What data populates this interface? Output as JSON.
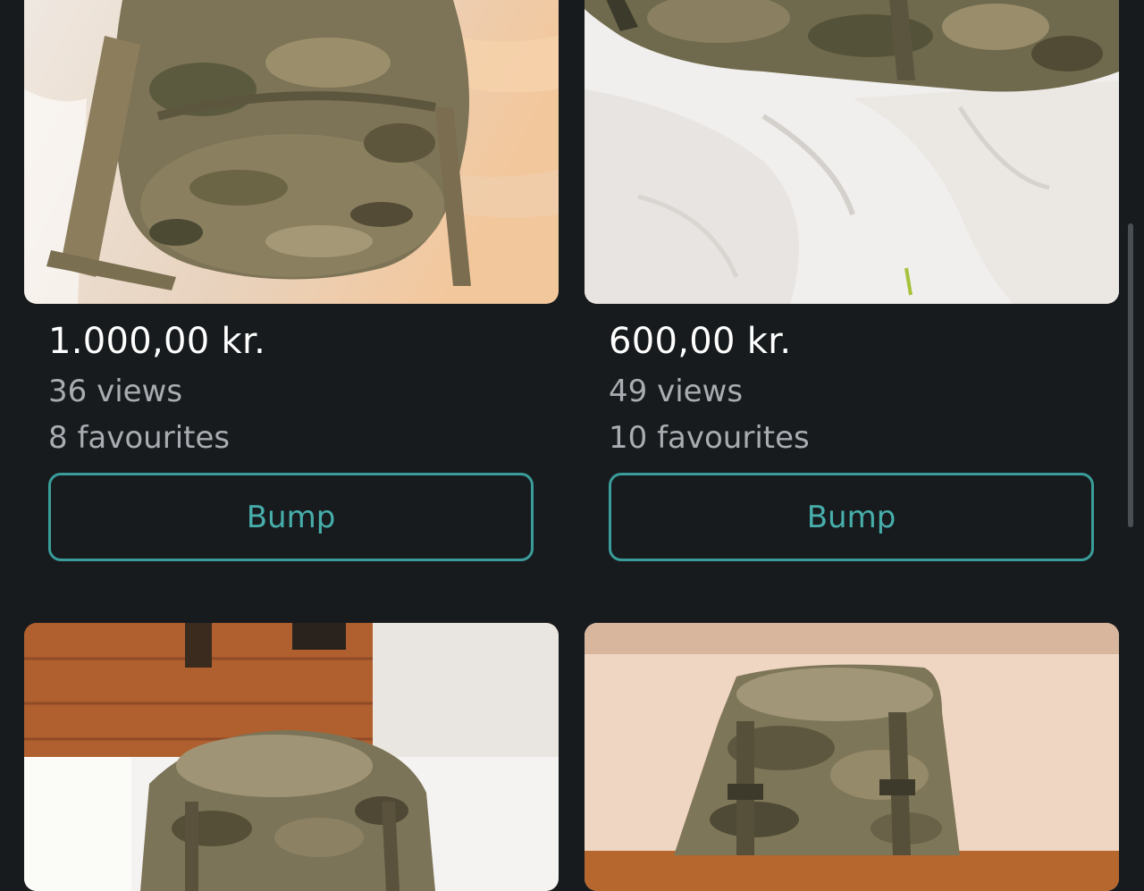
{
  "listings": [
    {
      "price": "1.000,00 kr.",
      "views": "36 views",
      "favourites": "8 favourites",
      "bump_label": "Bump",
      "image": "camouflage-backpack-on-bed"
    },
    {
      "price": "600,00 kr.",
      "views": "49 views",
      "favourites": "10 favourites",
      "bump_label": "Bump",
      "image": "camouflage-backpack-on-white-duvet"
    },
    {
      "image": "camouflage-backpack-on-bed-near-wood-floor"
    },
    {
      "image": "camouflage-backpack-against-wall"
    }
  ],
  "colors": {
    "background": "#171b1e",
    "accent": "#47aeab",
    "price_text": "#ffffff",
    "meta_text": "#a9adb1"
  }
}
